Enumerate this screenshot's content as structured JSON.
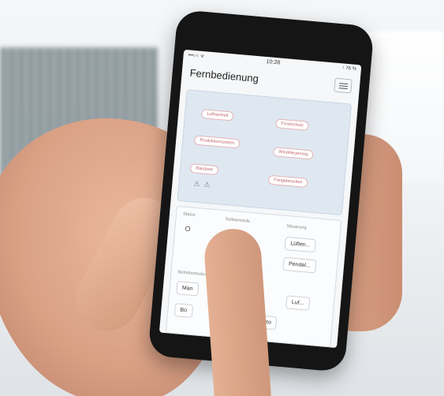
{
  "app": {
    "title": "Fernbedienung",
    "status_time": "10:28",
    "status_left": "•••○○ ᯤ",
    "status_right": "↑ 76 %"
  },
  "scenes": [
    {
      "label": "Luftreinheit"
    },
    {
      "label": "Frostschutz"
    },
    {
      "label": "Produktionszeiten"
    },
    {
      "label": "Windsteuerung"
    },
    {
      "label": "Randzeit"
    },
    {
      "label": "Freigabezeiten"
    }
  ],
  "controls": {
    "col_labels": [
      "Status",
      "Sollwertstufe",
      "Steuerung"
    ],
    "power_symbol": "O",
    "stepper": "- - +",
    "buttons_right": [
      "Lüften...",
      "Pendel..."
    ],
    "section_label": "Betriebsmodus",
    "mode_buttons": [
      "Man",
      "Luf...",
      "Bo",
      "Auto"
    ]
  },
  "colors": {
    "accent_chip": "#c0626a",
    "panel_blue": "#dfe8f1",
    "phone_body": "#151515"
  }
}
